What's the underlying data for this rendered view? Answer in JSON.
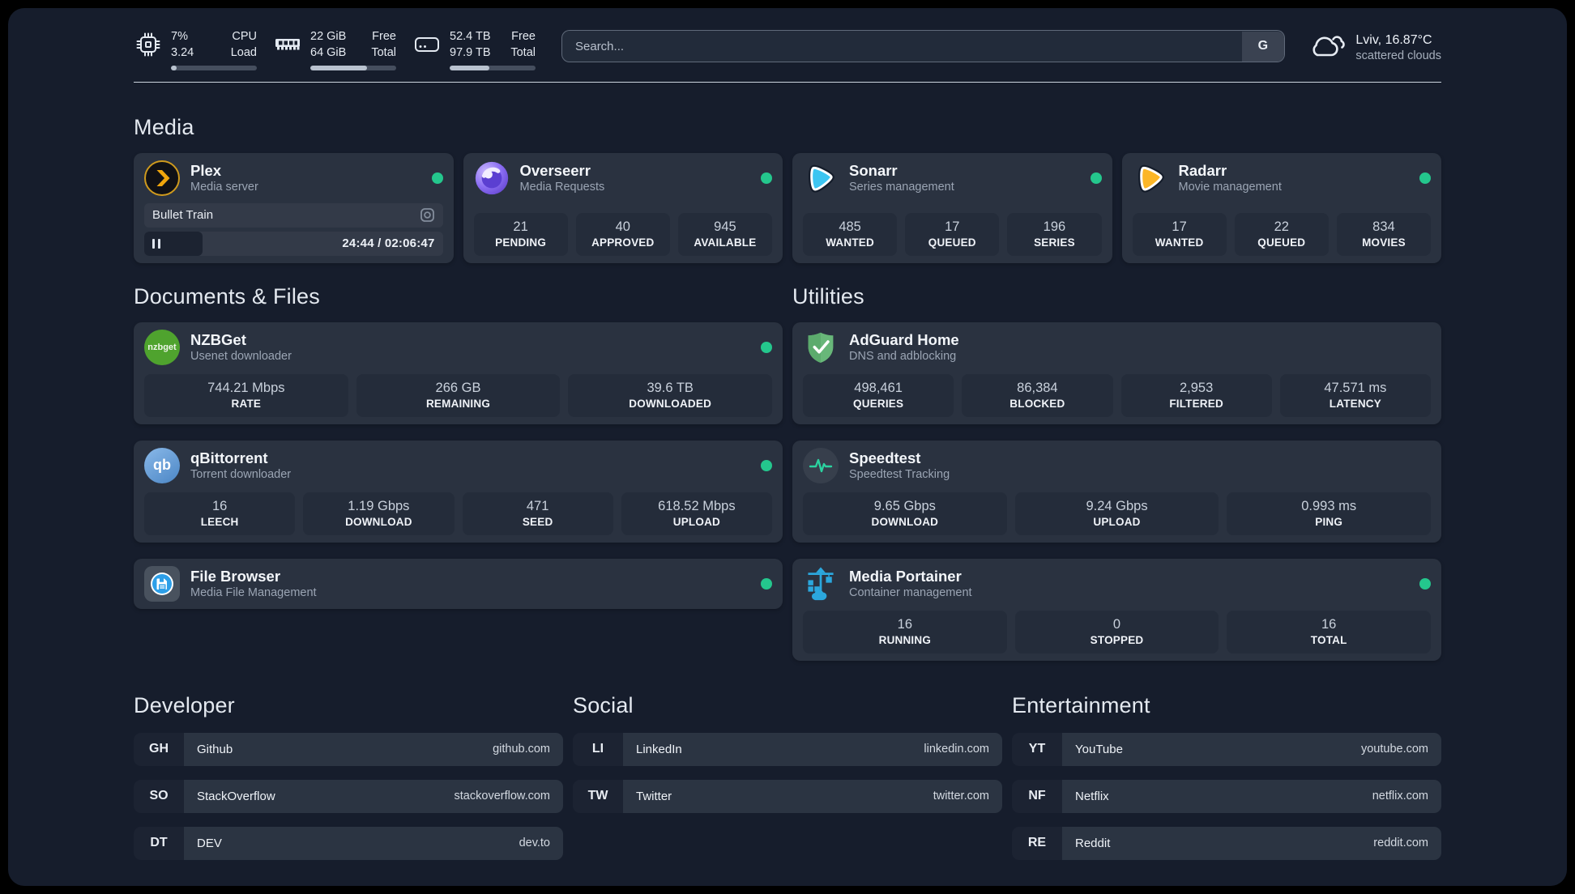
{
  "colors": {
    "status_green": "#24c78d",
    "accent_plex": "#e5a00d",
    "accent_sonarr": "#3cc5f1",
    "accent_radarr": "#fcb626"
  },
  "topbar": {
    "cpu": {
      "line1": "7%",
      "line2": "3.24",
      "label1": "CPU",
      "label2": "Load",
      "percent": 7
    },
    "ram": {
      "line1": "22 GiB",
      "line2": "64 GiB",
      "label1": "Free",
      "label2": "Total",
      "percent": 66
    },
    "disk": {
      "line1": "52.4 TB",
      "line2": "97.9 TB",
      "label1": "Free",
      "label2": "Total",
      "percent": 46.5
    },
    "search": {
      "placeholder": "Search...",
      "provider": "G"
    },
    "weather": {
      "line1": "Lviv, 16.87°C",
      "line2": "scattered clouds"
    }
  },
  "sections": {
    "media": {
      "title": "Media"
    },
    "documents": {
      "title": "Documents & Files"
    },
    "utilities": {
      "title": "Utilities"
    },
    "developer": {
      "title": "Developer"
    },
    "social": {
      "title": "Social"
    },
    "entertainment": {
      "title": "Entertainment"
    }
  },
  "apps": {
    "plex": {
      "name": "Plex",
      "desc": "Media server",
      "now_playing": "Bullet Train",
      "time": "24:44 / 02:06:47",
      "progress_percent": 19.5
    },
    "overseerr": {
      "name": "Overseerr",
      "desc": "Media Requests",
      "stats": [
        {
          "value": "21",
          "label": "PENDING"
        },
        {
          "value": "40",
          "label": "APPROVED"
        },
        {
          "value": "945",
          "label": "AVAILABLE"
        }
      ]
    },
    "sonarr": {
      "name": "Sonarr",
      "desc": "Series management",
      "stats": [
        {
          "value": "485",
          "label": "WANTED"
        },
        {
          "value": "17",
          "label": "QUEUED"
        },
        {
          "value": "196",
          "label": "SERIES"
        }
      ]
    },
    "radarr": {
      "name": "Radarr",
      "desc": "Movie management",
      "stats": [
        {
          "value": "17",
          "label": "WANTED"
        },
        {
          "value": "22",
          "label": "QUEUED"
        },
        {
          "value": "834",
          "label": "MOVIES"
        }
      ]
    },
    "nzbget": {
      "name": "NZBGet",
      "desc": "Usenet downloader",
      "icon_text": "nzbget",
      "stats": [
        {
          "value": "744.21 Mbps",
          "label": "RATE"
        },
        {
          "value": "266 GB",
          "label": "REMAINING"
        },
        {
          "value": "39.6 TB",
          "label": "DOWNLOADED"
        }
      ]
    },
    "qbittorrent": {
      "name": "qBittorrent",
      "desc": "Torrent downloader",
      "icon_text": "qb",
      "stats": [
        {
          "value": "16",
          "label": "LEECH"
        },
        {
          "value": "1.19 Gbps",
          "label": "DOWNLOAD"
        },
        {
          "value": "471",
          "label": "SEED"
        },
        {
          "value": "618.52 Mbps",
          "label": "UPLOAD"
        }
      ]
    },
    "filebrowser": {
      "name": "File Browser",
      "desc": "Media File Management"
    },
    "adguard": {
      "name": "AdGuard Home",
      "desc": "DNS and adblocking",
      "stats": [
        {
          "value": "498,461",
          "label": "QUERIES"
        },
        {
          "value": "86,384",
          "label": "BLOCKED"
        },
        {
          "value": "2,953",
          "label": "FILTERED"
        },
        {
          "value": "47.571 ms",
          "label": "LATENCY"
        }
      ]
    },
    "speedtest": {
      "name": "Speedtest",
      "desc": "Speedtest Tracking",
      "stats": [
        {
          "value": "9.65 Gbps",
          "label": "DOWNLOAD"
        },
        {
          "value": "9.24 Gbps",
          "label": "UPLOAD"
        },
        {
          "value": "0.993 ms",
          "label": "PING"
        }
      ]
    },
    "portainer": {
      "name": "Media Portainer",
      "desc": "Container management",
      "stats": [
        {
          "value": "16",
          "label": "RUNNING"
        },
        {
          "value": "0",
          "label": "STOPPED"
        },
        {
          "value": "16",
          "label": "TOTAL"
        }
      ]
    }
  },
  "links": {
    "developer": [
      {
        "abbr": "GH",
        "name": "Github",
        "url": "github.com"
      },
      {
        "abbr": "SO",
        "name": "StackOverflow",
        "url": "stackoverflow.com"
      },
      {
        "abbr": "DT",
        "name": "DEV",
        "url": "dev.to"
      }
    ],
    "social": [
      {
        "abbr": "LI",
        "name": "LinkedIn",
        "url": "linkedin.com"
      },
      {
        "abbr": "TW",
        "name": "Twitter",
        "url": "twitter.com"
      }
    ],
    "entertainment": [
      {
        "abbr": "YT",
        "name": "YouTube",
        "url": "youtube.com"
      },
      {
        "abbr": "NF",
        "name": "Netflix",
        "url": "netflix.com"
      },
      {
        "abbr": "RE",
        "name": "Reddit",
        "url": "reddit.com"
      }
    ]
  }
}
